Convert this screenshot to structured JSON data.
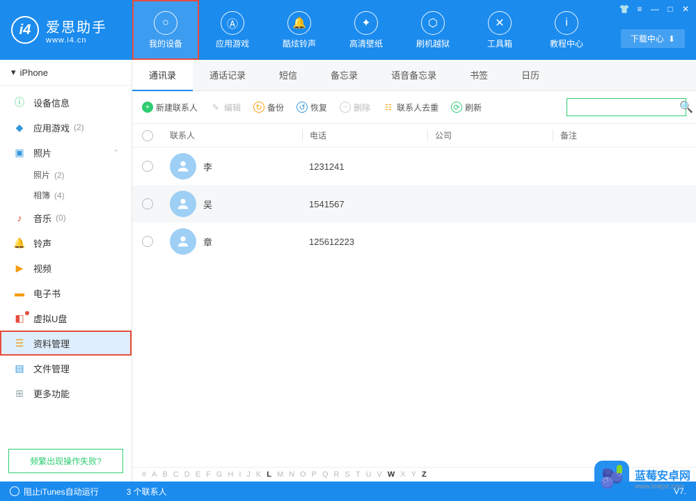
{
  "app": {
    "title": "爱思助手",
    "subtitle": "www.i4.cn"
  },
  "window_controls": {
    "download_center": "下载中心"
  },
  "nav": [
    {
      "id": "device",
      "label": "我的设备",
      "active": true,
      "highlighted": true
    },
    {
      "id": "apps",
      "label": "应用游戏"
    },
    {
      "id": "ringtones",
      "label": "酷炫铃声"
    },
    {
      "id": "wallpapers",
      "label": "高清壁纸"
    },
    {
      "id": "flash",
      "label": "刷机越狱"
    },
    {
      "id": "toolbox",
      "label": "工具箱"
    },
    {
      "id": "tutorial",
      "label": "教程中心"
    }
  ],
  "sidebar": {
    "device": "iPhone",
    "items": [
      {
        "id": "info",
        "label": "设备信息",
        "icon_color": "#2ecc71"
      },
      {
        "id": "apps",
        "label": "应用游戏",
        "count": "(2)",
        "icon_color": "#3498db"
      },
      {
        "id": "photos",
        "label": "照片",
        "icon_color": "#3498db",
        "expanded": true,
        "children": [
          {
            "label": "照片",
            "count": "(2)"
          },
          {
            "label": "相簿",
            "count": "(4)"
          }
        ]
      },
      {
        "id": "music",
        "label": "音乐",
        "count": "(0)",
        "icon_color": "#e74c3c"
      },
      {
        "id": "ringtone",
        "label": "铃声",
        "icon_color": "#3498db"
      },
      {
        "id": "video",
        "label": "视频",
        "icon_color": "#f39c12"
      },
      {
        "id": "ebook",
        "label": "电子书",
        "icon_color": "#f39c12"
      },
      {
        "id": "udisk",
        "label": "虚拟U盘",
        "icon_color": "#e74c3c",
        "dot": true
      },
      {
        "id": "data",
        "label": "资料管理",
        "icon_color": "#f39c12",
        "selected": true,
        "highlighted": true
      },
      {
        "id": "files",
        "label": "文件管理",
        "icon_color": "#3498db"
      },
      {
        "id": "more",
        "label": "更多功能",
        "icon_color": "#95a5a6"
      }
    ],
    "help": "频繁出现操作失败?"
  },
  "tabs": [
    {
      "label": "通讯录",
      "active": true
    },
    {
      "label": "通话记录"
    },
    {
      "label": "短信"
    },
    {
      "label": "备忘录"
    },
    {
      "label": "语音备忘录"
    },
    {
      "label": "书签"
    },
    {
      "label": "日历"
    }
  ],
  "toolbar": {
    "new_contact": "新建联系人",
    "edit": "编辑",
    "backup": "备份",
    "restore": "恢复",
    "delete": "删除",
    "dedupe": "联系人去重",
    "refresh": "刷新"
  },
  "columns": {
    "contact": "联系人",
    "phone": "电话",
    "company": "公司",
    "note": "备注"
  },
  "contacts": [
    {
      "name": "李",
      "phone": "1231241",
      "company": "",
      "note": ""
    },
    {
      "name": "吴",
      "phone": "1541567",
      "company": "",
      "note": ""
    },
    {
      "name": "章",
      "phone": "125612223",
      "company": "",
      "note": ""
    }
  ],
  "alpha": [
    "#",
    "A",
    "B",
    "C",
    "D",
    "E",
    "F",
    "G",
    "H",
    "I",
    "J",
    "K",
    "L",
    "M",
    "N",
    "O",
    "P",
    "Q",
    "R",
    "S",
    "T",
    "U",
    "V",
    "W",
    "X",
    "Y",
    "Z"
  ],
  "alpha_active": [
    "L",
    "W",
    "Z"
  ],
  "status": {
    "itunes": "阻止iTunes自动运行",
    "count": "3 个联系人",
    "version": "V7."
  },
  "watermark": {
    "name": "蓝莓安卓网",
    "url": "www.lmkjst.com"
  }
}
